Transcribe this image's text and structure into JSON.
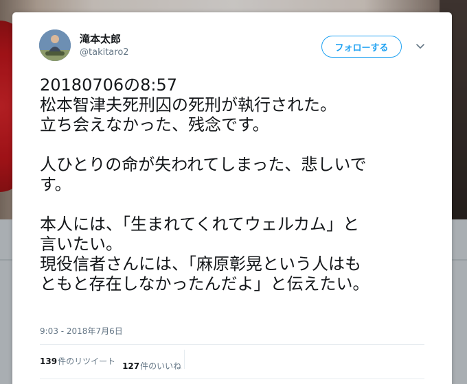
{
  "tweet": {
    "user": {
      "name": "滝本太郎",
      "handle": "@takitaro2",
      "avatar_icon": "avatar-photo"
    },
    "follow_label": "フォローする",
    "more_icon": "chevron-down-icon",
    "text": "20180706の8:57\n松本智津夫死刑囚の死刑が執行された。\n立ち会えなかった、残念です。\n\n人ひとりの命が失われてしまった、悲しいで\nす。\n\n本人には、「生まれてくれてウェルカム」と\n言いたい。\n現役信者さんには、「麻原彰晃という人はも\nともと存在しなかったんだよ」と伝えたい。",
    "timestamp": "9:03 - 2018年7月6日",
    "retweets": {
      "count": "139",
      "label": "件のリツイート"
    },
    "likes": {
      "count": "127",
      "label": "件のいいね"
    }
  },
  "colors": {
    "accent": "#1da1f2",
    "text_primary": "#14171a",
    "text_secondary": "#657786",
    "divider": "#e6ecf0"
  }
}
